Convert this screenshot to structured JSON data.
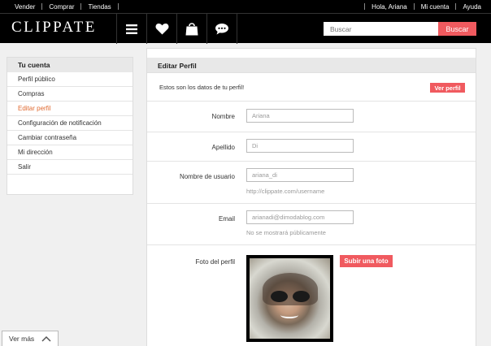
{
  "topbar": {
    "left_links": [
      "Vender",
      "Comprar",
      "Tiendas"
    ],
    "greeting": "Hola, Ariana",
    "account": "Mi cuenta",
    "help": "Ayuda"
  },
  "header": {
    "logo": "CLIPPATE",
    "icons": [
      "menu-icon",
      "heart-icon",
      "shopping-bag-icon",
      "chat-icon"
    ],
    "search_placeholder": "Buscar",
    "search_button": "Buscar"
  },
  "sidebar": {
    "title": "Tu cuenta",
    "items": [
      {
        "label": "Perfil público",
        "active": false
      },
      {
        "label": "Compras",
        "active": false
      },
      {
        "label": "Editar perfil",
        "active": true
      },
      {
        "label": "Configuración de notificación",
        "active": false
      },
      {
        "label": "Cambiar contraseña",
        "active": false
      },
      {
        "label": "Mi dirección",
        "active": false
      },
      {
        "label": "Salir",
        "active": false
      }
    ]
  },
  "main": {
    "title": "Editar Perfil",
    "intro": "Estos son los datos de tu perfil!",
    "view_profile_button": "Ver perfil",
    "fields": {
      "nombre": {
        "label": "Nombre",
        "value": "Ariana"
      },
      "apellido": {
        "label": "Apellido",
        "value": "Di"
      },
      "usuario": {
        "label": "Nombre de usuario",
        "value": "ariana_di",
        "hint": "http://clippate.com/username"
      },
      "email": {
        "label": "Email",
        "value": "arianadi@dimodablog.com",
        "hint": "No se mostrará públicamente"
      },
      "foto": {
        "label": "Foto del perfil",
        "upload_button": "Subir una foto"
      }
    }
  },
  "footer": {
    "ver_mas": "Ver más"
  },
  "colors": {
    "accent": "#f05a5f",
    "active_link": "#e06a31"
  }
}
